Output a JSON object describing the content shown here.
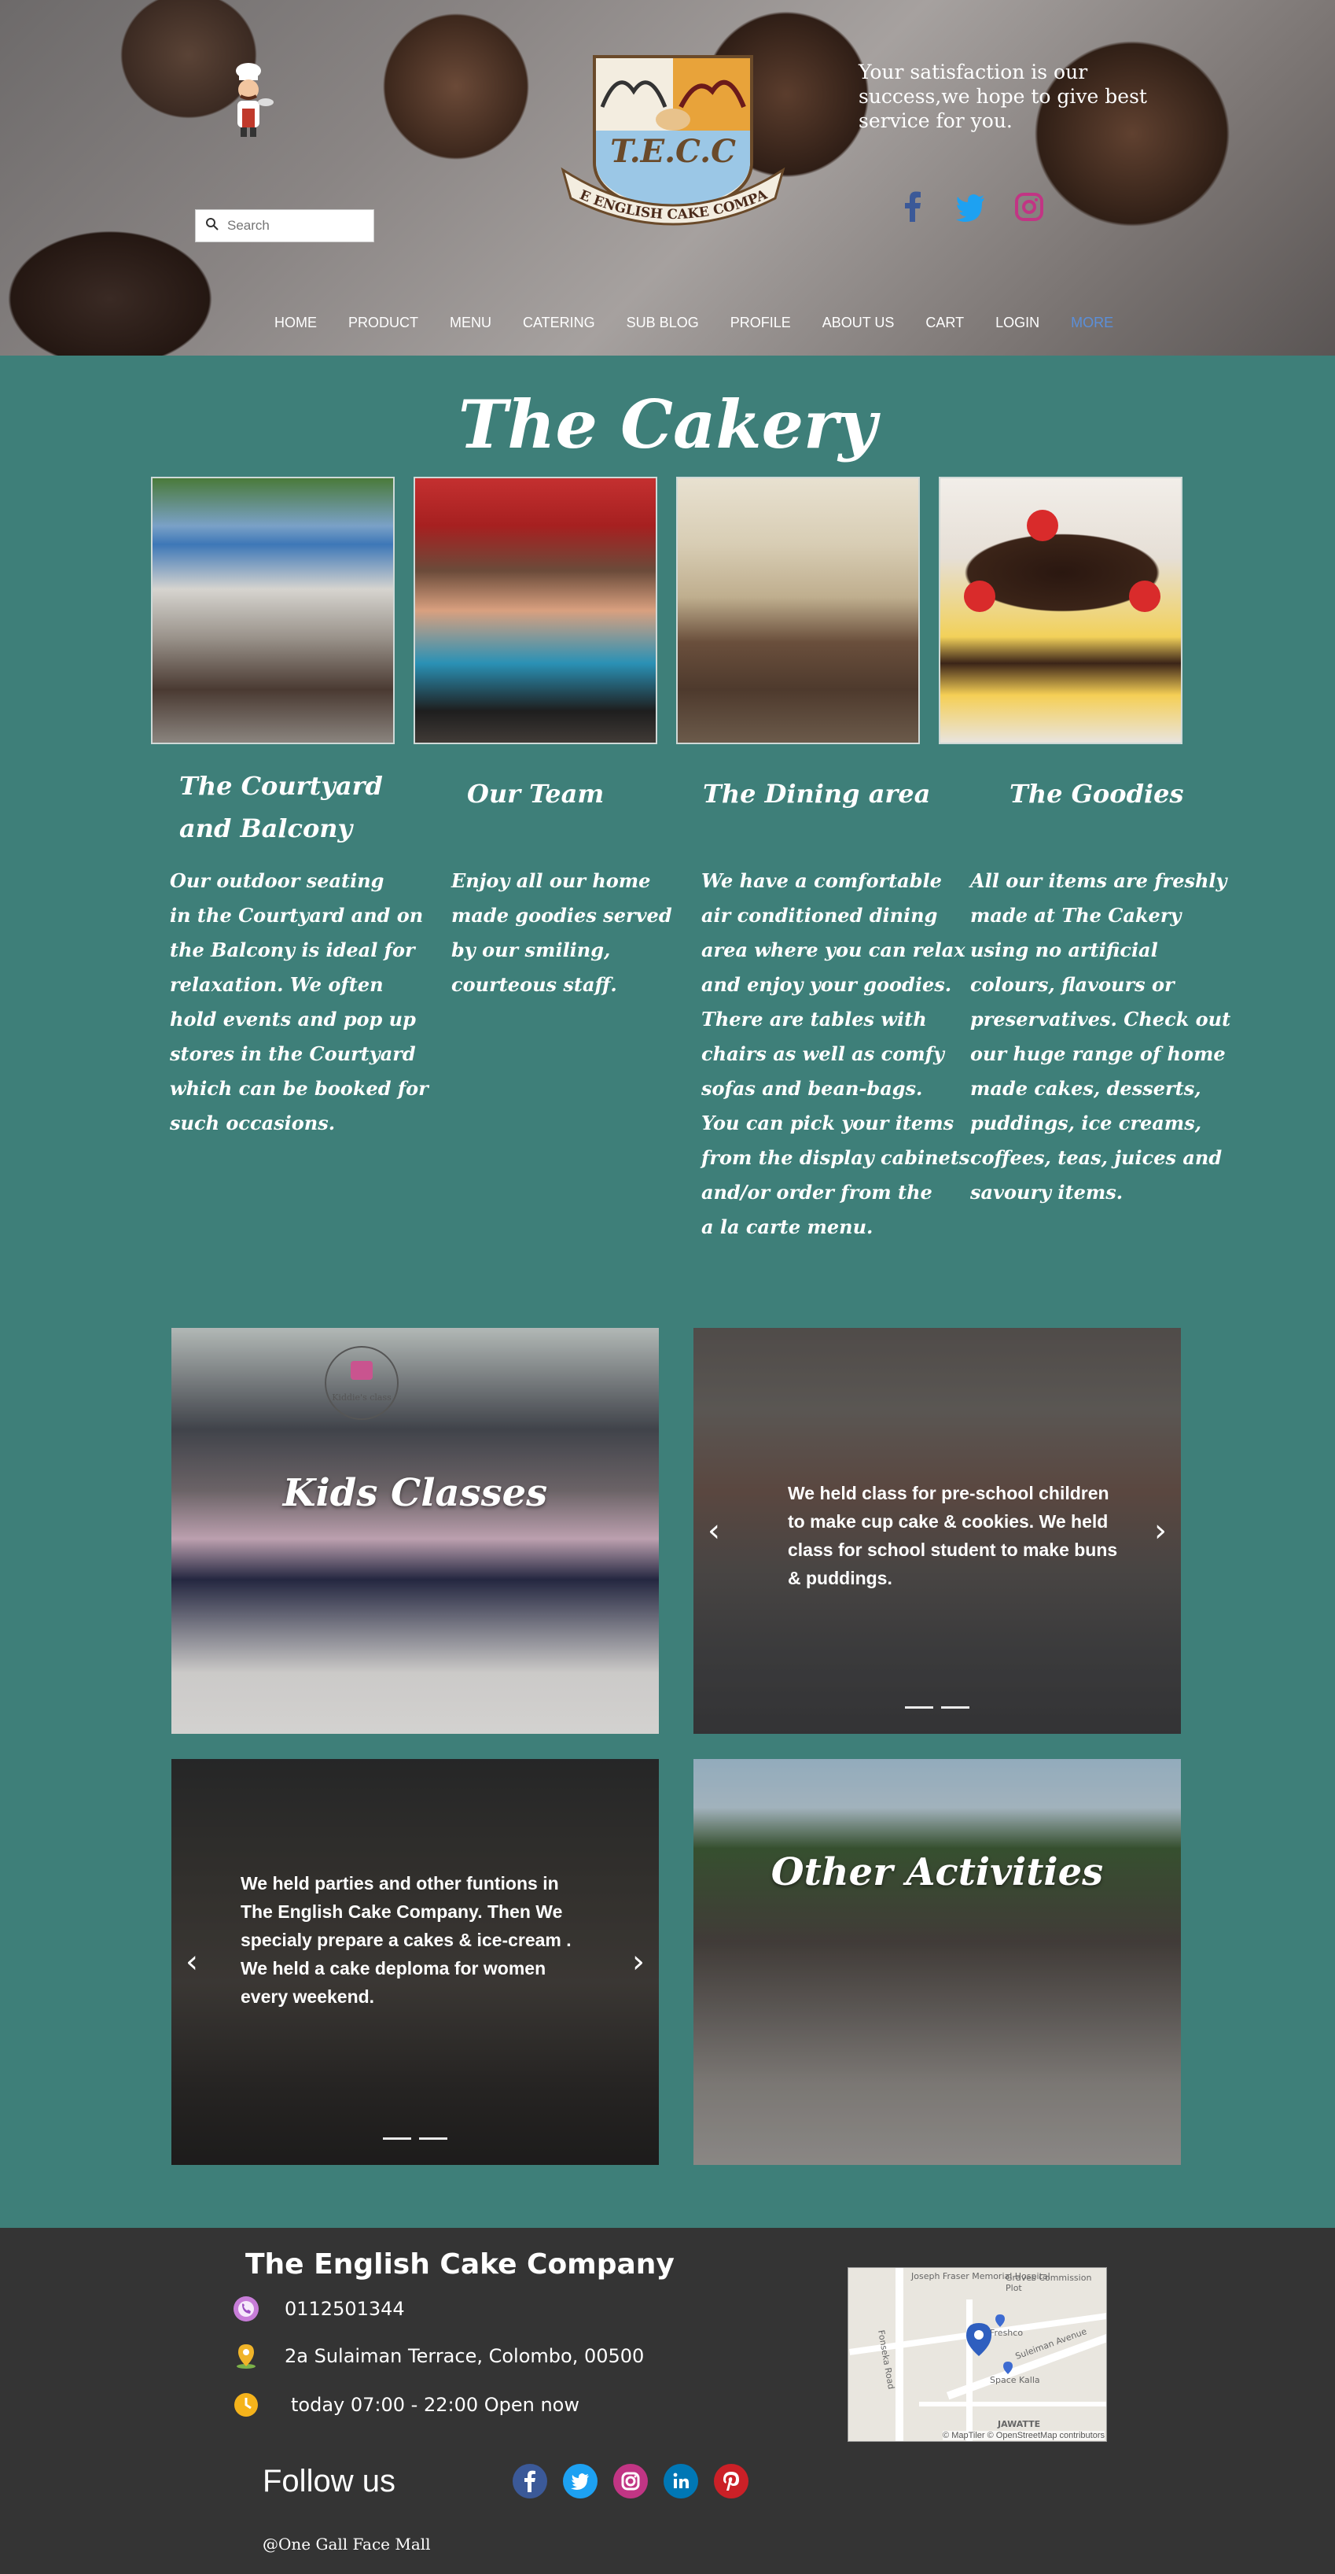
{
  "header": {
    "tagline": "Your satisfaction is our success,we hope to give best service for you.",
    "logo_text": "T.E.C.C",
    "logo_banner": "THE ENGLISH CAKE COMPANY",
    "search_placeholder": "Search",
    "nav": [
      "HOME",
      "PRODUCT",
      "MENU",
      "CATERING",
      "SUB BLOG",
      "PROFILE",
      "ABOUT US",
      "CART",
      "LOGIN",
      "MORE"
    ],
    "social_icons": [
      "facebook-icon",
      "twitter-icon",
      "instagram-icon"
    ]
  },
  "cakery": {
    "title": "The Cakery",
    "columns": [
      {
        "title": "The Courtyard\nand Balcony",
        "text": "Our outdoor seating\nin the Courtyard and on\nthe Balcony is ideal for\nrelaxation. We often\nhold events and pop up\nstores in the Courtyard\nwhich can be booked for\nsuch occasions."
      },
      {
        "title": "Our Team",
        "text": "Enjoy all our home\nmade goodies served\nby our smiling,\ncourteous staff."
      },
      {
        "title": "The Dining area",
        "text": "We have a comfortable\nair conditioned dining\narea where you can relax\nand enjoy your goodies.\nThere are tables with\nchairs as well as comfy\nsofas and bean-bags.\nYou can pick your items\nfrom the display cabinets\nand/or order from the\na la carte menu."
      },
      {
        "title": "The Goodies",
        "text": "All our items are freshly\nmade at The Cakery\nusing no artificial\ncolours, flavours or\npreservatives. Check out\nour huge range of home\nmade cakes, desserts,\npuddings, ice creams,\ncoffees, teas, juices and\nsavoury items."
      }
    ]
  },
  "activities": {
    "kids_title": "Kids Classes",
    "kids_slide_text": "We held class for pre-school children to make cup cake & cookies. We held class for school student to make buns & puddings.",
    "party_slide_text": "We held parties and other funtions in The English Cake Company. Then We specialy prepare a cakes & ice-cream .\nWe held a cake deploma for women every weekend.",
    "other_title": "Other Activities",
    "kids_badge": "Kiddie's class"
  },
  "footer": {
    "company": "The English Cake Company",
    "phone": "0112501344",
    "address": "2a Sulaiman Terrace, Colombo, 00500",
    "hours": "today 07:00 - 22:00 Open now",
    "follow": "Follow us",
    "location_note": "@One Gall Face Mall",
    "map_attribution": "© MapTiler © OpenStreetMap contributors",
    "map_labels": [
      "Joseph Fraser Memorial Hospital",
      "Graves Commission Plot",
      "Suleiman Avenue",
      "Fonseka Road",
      "Freshco",
      "Space Kalla",
      "JAWATTE"
    ],
    "social_icons": [
      "facebook-icon",
      "twitter-icon",
      "instagram-icon",
      "linkedin-icon",
      "pinterest-icon"
    ]
  }
}
